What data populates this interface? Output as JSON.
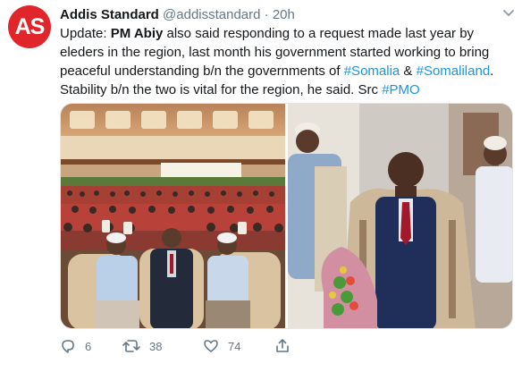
{
  "author": {
    "avatar_text": "AS",
    "display_name": "Addis Standard",
    "handle": "@addisstandard",
    "separator": "·",
    "time": "20h"
  },
  "tweet": {
    "prefix": "Update: ",
    "bold": "PM Abiy",
    "part1": " also said responding to a request made last year by eleders in the region, last month his government started working to bring peaceful understanding b/n the governments of ",
    "hashtag1": "#Somalia",
    "part2": " & ",
    "hashtag2": "#Somaliland",
    "part3": ". Stability b/n the two is vital for the region, he said. Src ",
    "hashtag3": "#PMO"
  },
  "media": {
    "photos": [
      {
        "description": "conference-hall-audience"
      },
      {
        "description": "scarf-ceremony"
      }
    ]
  },
  "actions": {
    "replies": "6",
    "retweets": "38",
    "likes": "74"
  },
  "colors": {
    "brand_red": "#e0262b",
    "link_blue": "#1b95e0",
    "muted_gray": "#657786",
    "text": "#14171a"
  },
  "icons": [
    "reply-icon",
    "retweet-icon",
    "like-icon",
    "share-icon",
    "chevron-down-icon"
  ]
}
